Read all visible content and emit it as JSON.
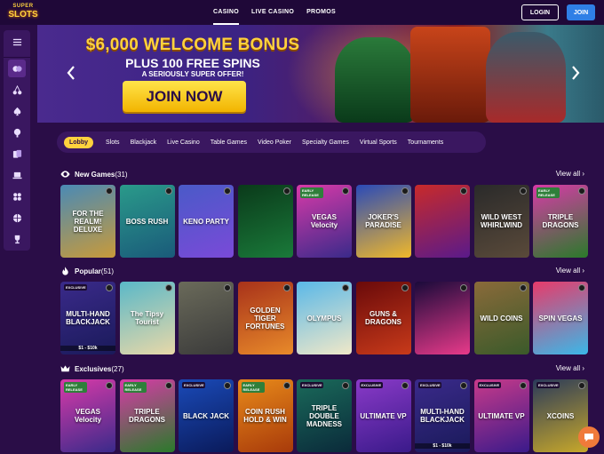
{
  "logo": {
    "line1": "SUPER",
    "line2": "SLOTS"
  },
  "nav": [
    {
      "label": "CASINO",
      "active": true
    },
    {
      "label": "LIVE CASINO",
      "active": false
    },
    {
      "label": "PROMOS",
      "active": false
    }
  ],
  "auth": {
    "login": "LOGIN",
    "join": "JOIN"
  },
  "sidebar": {
    "items": [
      {
        "icon": "menu-icon"
      },
      {
        "icon": "casino-chips-icon",
        "active": true
      },
      {
        "icon": "cherries-icon"
      },
      {
        "icon": "spade-icon"
      },
      {
        "icon": "microphone-icon"
      },
      {
        "icon": "video-poker-cards-icon"
      },
      {
        "icon": "laptop-icon"
      },
      {
        "icon": "specialty-games-icon"
      },
      {
        "icon": "basketball-icon"
      },
      {
        "icon": "trophy-icon"
      }
    ]
  },
  "banner": {
    "title": "$6,000 WELCOME BONUS",
    "subtitle": "PLUS 100 FREE SPINS",
    "tagline": "A SERIOUSLY SUPER OFFER!",
    "cta": "JOIN NOW"
  },
  "categories": [
    {
      "label": "Lobby",
      "active": true
    },
    {
      "label": "Slots"
    },
    {
      "label": "Blackjack"
    },
    {
      "label": "Live Casino"
    },
    {
      "label": "Table Games"
    },
    {
      "label": "Video Poker"
    },
    {
      "label": "Specialty Games"
    },
    {
      "label": "Virtual Sports"
    },
    {
      "label": "Tournaments"
    }
  ],
  "sections": {
    "new_games": {
      "title": "New Games",
      "count": "(31)",
      "view_all": "View all",
      "icon": "eye-icon",
      "games": [
        {
          "name": "FOR THE REALM! DELUXE",
          "colors": [
            "#4a8ab5",
            "#c89a3a"
          ]
        },
        {
          "name": "BOSS RUSH",
          "colors": [
            "#2a9a8a",
            "#1a5a7a"
          ]
        },
        {
          "name": "KENO PARTY",
          "colors": [
            "#4a5ac8",
            "#7a4ad8"
          ]
        },
        {
          "name": "",
          "colors": [
            "#0a3a1a",
            "#1a7a3a"
          ]
        },
        {
          "name": "VEGAS Velocity",
          "badge": "EARLY RELEASE",
          "colors": [
            "#d83aa8",
            "#3a2a8a"
          ]
        },
        {
          "name": "JOKER'S PARADISE",
          "colors": [
            "#2a4ab8",
            "#f0b82a"
          ]
        },
        {
          "name": "",
          "colors": [
            "#c82a2a",
            "#5a1a8a"
          ]
        },
        {
          "name": "WILD WEST WHIRLWIND",
          "colors": [
            "#2a2a2a",
            "#5a4a3a"
          ]
        },
        {
          "name": "TRIPLE DRAGONS",
          "badge": "EARLY RELEASE",
          "colors": [
            "#d83aa8",
            "#2a7a2a"
          ]
        }
      ]
    },
    "popular": {
      "title": "Popular",
      "count": "(51)",
      "view_all": "View all",
      "icon": "flame-icon",
      "games": [
        {
          "name": "MULTI-HAND BLACKJACK",
          "badge": "EXCLUSIVE",
          "extra": "$1 - $10k",
          "colors": [
            "#3a2a8a",
            "#1a1a5a"
          ]
        },
        {
          "name": "The Tipsy Tourist",
          "colors": [
            "#5ab8c8",
            "#e8d8a8"
          ]
        },
        {
          "name": "",
          "colors": [
            "#6a6a5a",
            "#3a3a3a"
          ]
        },
        {
          "name": "GOLDEN TIGER FORTUNES",
          "colors": [
            "#a8321a",
            "#e88a2a"
          ]
        },
        {
          "name": "OLYMPUS",
          "colors": [
            "#5ab8e8",
            "#f0e8c8"
          ]
        },
        {
          "name": "GUNS & DRAGONS",
          "colors": [
            "#6a0a0a",
            "#c83a1a"
          ]
        },
        {
          "name": "",
          "colors": [
            "#1a0a3a",
            "#e83a8a"
          ]
        },
        {
          "name": "WILD COINS",
          "colors": [
            "#8a6a3a",
            "#3a5a2a"
          ]
        },
        {
          "name": "SPIN VEGAS",
          "colors": [
            "#e83a6a",
            "#3ab8e8"
          ]
        }
      ]
    },
    "exclusives": {
      "title": "Exclusives",
      "count": "(27)",
      "view_all": "View all",
      "icon": "crown-icon",
      "games": [
        {
          "name": "VEGAS Velocity",
          "badge": "EARLY RELEASE",
          "colors": [
            "#d83aa8",
            "#3a2a8a"
          ]
        },
        {
          "name": "TRIPLE DRAGONS",
          "badge": "EARLY RELEASE",
          "colors": [
            "#d83aa8",
            "#2a7a2a"
          ]
        },
        {
          "name": "BLACK JACK",
          "badge": "EXCLUSIVE",
          "colors": [
            "#1a4ab8",
            "#0a1a5a"
          ]
        },
        {
          "name": "COIN RUSH HOLD & WIN",
          "badge": "EARLY RELEASE",
          "colors": [
            "#e88a1a",
            "#a83a0a"
          ]
        },
        {
          "name": "TRIPLE DOUBLE MADNESS",
          "badge": "EXCLUSIVE",
          "colors": [
            "#1a6a5a",
            "#0a2a3a"
          ]
        },
        {
          "name": "ULTIMATE VP",
          "badge": "EXCLUSIVE",
          "colors": [
            "#8a3ac8",
            "#3a1a8a"
          ]
        },
        {
          "name": "MULTI-HAND BLACKJACK",
          "badge": "EXCLUSIVE",
          "extra": "$1 - $10k",
          "colors": [
            "#3a2a8a",
            "#1a1a5a"
          ]
        },
        {
          "name": "ULTIMATE VP",
          "badge": "EXCLUSIVE",
          "colors": [
            "#c83a8a",
            "#3a1a8a"
          ]
        },
        {
          "name": "XCOINS",
          "badge": "EXCLUSIVE",
          "colors": [
            "#2a3a5a",
            "#c8a82a"
          ]
        }
      ]
    }
  }
}
